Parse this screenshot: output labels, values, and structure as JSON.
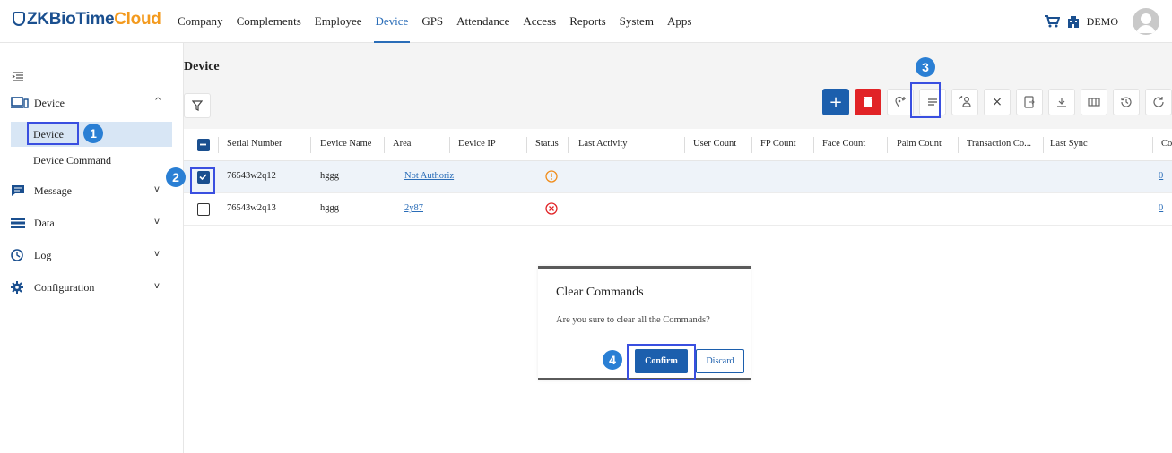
{
  "app": {
    "logo_part1": "ZKBioTime",
    "logo_part2": "Cloud",
    "brand_colors": {
      "primary": "#1a4f8f",
      "accent": "#f39a1e",
      "action_blue": "#1c5fad",
      "danger": "#e12326",
      "annotation": "#3a4fe0",
      "badge": "#2a7fd4"
    }
  },
  "nav": {
    "items": [
      {
        "label": "Company"
      },
      {
        "label": "Complements"
      },
      {
        "label": "Employee"
      },
      {
        "label": "Device",
        "active": true
      },
      {
        "label": "GPS"
      },
      {
        "label": "Attendance"
      },
      {
        "label": "Access"
      },
      {
        "label": "Reports"
      },
      {
        "label": "System"
      },
      {
        "label": "Apps"
      }
    ],
    "company": "DEMO"
  },
  "sidebar": {
    "groups": [
      {
        "label": "Device",
        "icon": "device-icon",
        "expanded": true,
        "items": [
          {
            "label": "Device",
            "active": true
          },
          {
            "label": "Device Command"
          }
        ]
      },
      {
        "label": "Message",
        "icon": "message-icon"
      },
      {
        "label": "Data",
        "icon": "data-icon"
      },
      {
        "label": "Log",
        "icon": "clock-icon"
      },
      {
        "label": "Configuration",
        "icon": "gear-icon"
      }
    ]
  },
  "main": {
    "title": "Device",
    "toolbar_icons": [
      "plus-icon",
      "trash-icon",
      "location-plus-icon",
      "clear-commands-icon",
      "sync-users-icon",
      "close-icon",
      "device-transfer-icon",
      "download-icon",
      "columns-icon",
      "history-icon",
      "refresh-icon"
    ]
  },
  "table": {
    "columns": [
      "Serial Number",
      "Device Name",
      "Area",
      "Device IP",
      "Status",
      "Last Activity",
      "User Count",
      "FP Count",
      "Face Count",
      "Palm Count",
      "Transaction Co...",
      "Last Sync",
      "Co"
    ],
    "rows": [
      {
        "serial": "76543w2q12",
        "name": "hggg",
        "area": "Not Authoriz",
        "status": "warning-icon",
        "last_col": "0",
        "checked": true
      },
      {
        "serial": "76543w2q13",
        "name": "hggg",
        "area": "2y87",
        "status": "error-icon",
        "last_col": "0",
        "checked": false
      }
    ]
  },
  "dialog": {
    "title": "Clear Commands",
    "message": "Are you sure to clear all the Commands?",
    "confirm": "Confirm",
    "discard": "Discard"
  },
  "annotations": {
    "badges": [
      "1",
      "2",
      "3",
      "4"
    ]
  }
}
